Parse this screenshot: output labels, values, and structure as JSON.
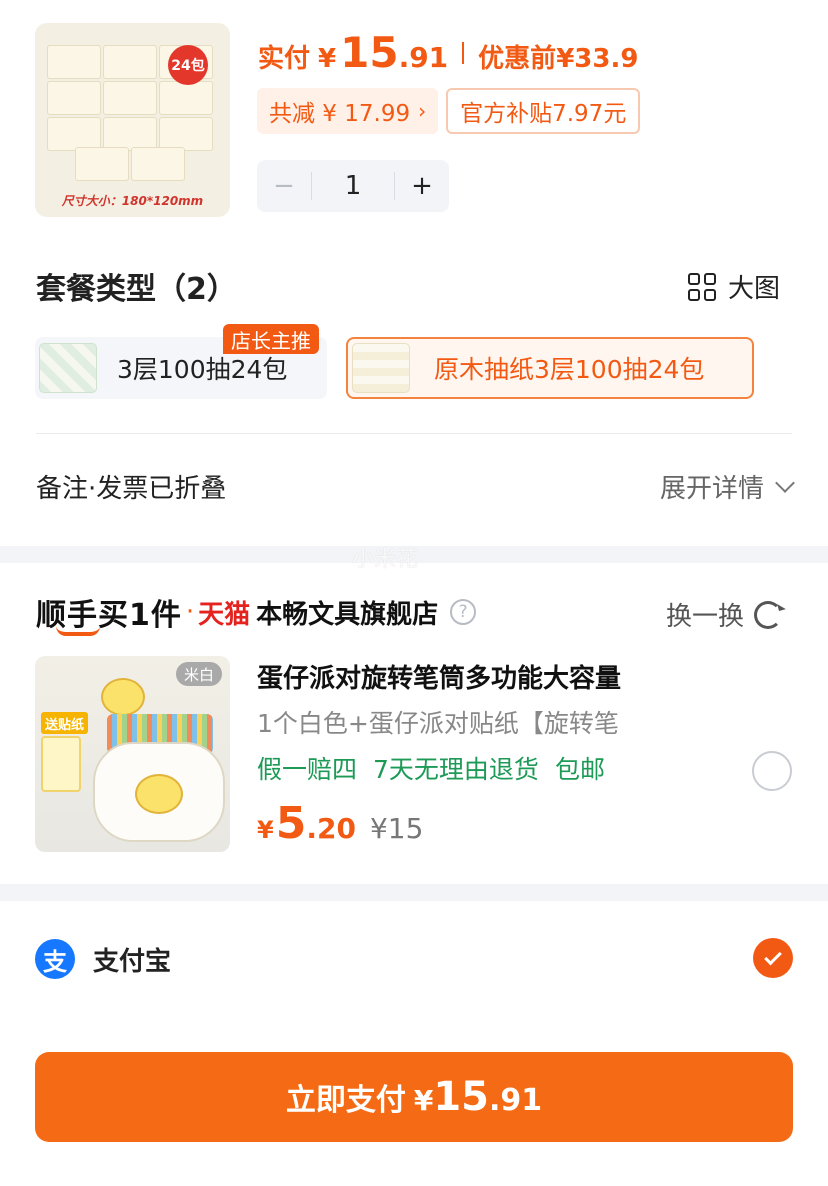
{
  "product": {
    "pack_badge": "24包",
    "size_caption": "尺寸大小：180*120mm",
    "paid_label": "实付",
    "currency": "¥",
    "price_int": "15",
    "price_dec": ".91",
    "before_discount_label": "优惠前",
    "before_discount_price": "¥33.9",
    "total_discount": "共减 ¥ 17.99",
    "subsidy": "官方补贴7.97元",
    "stepper": {
      "minus": "−",
      "quantity": "1",
      "plus": "+"
    }
  },
  "package_type": {
    "title": "套餐类型（2）",
    "big_view_label": "大图",
    "options": [
      {
        "label": "3层100抽24包",
        "tag": "店长主推",
        "selected": false
      },
      {
        "label": "原木抽纸3层100抽24包",
        "selected": true
      }
    ]
  },
  "remark": {
    "left": "备注·发票已折叠",
    "right": "展开详情"
  },
  "watermark": "小米花",
  "addon": {
    "brand": "顺手买1件",
    "dot": "·",
    "mall": "天猫",
    "store": "本畅文具旗舰店",
    "help_icon": "?",
    "swap_label": "换一换",
    "thumb_color_tag": "米白",
    "thumb_sticker_tag": "送贴纸",
    "title": "蛋仔派对旋转笔筒多功能大容量",
    "spec": "1个白色+蛋仔派对贴纸【旋转笔",
    "tags": [
      "假一赔四",
      "7天无理由退货",
      "包邮"
    ],
    "currency": "¥",
    "price_int": "5",
    "price_dec": ".20",
    "original_price": "¥15",
    "selected": false
  },
  "payment": {
    "icon_glyph": "支",
    "method": "支付宝",
    "selected": true
  },
  "pay_button": {
    "label": "立即支付",
    "currency": "¥",
    "price_int": "15",
    "price_dec": ".91"
  },
  "colors": {
    "accent": "#f25a14",
    "button": "#f56a14",
    "green_tag": "#1e9a57",
    "alipay": "#1677ff"
  }
}
